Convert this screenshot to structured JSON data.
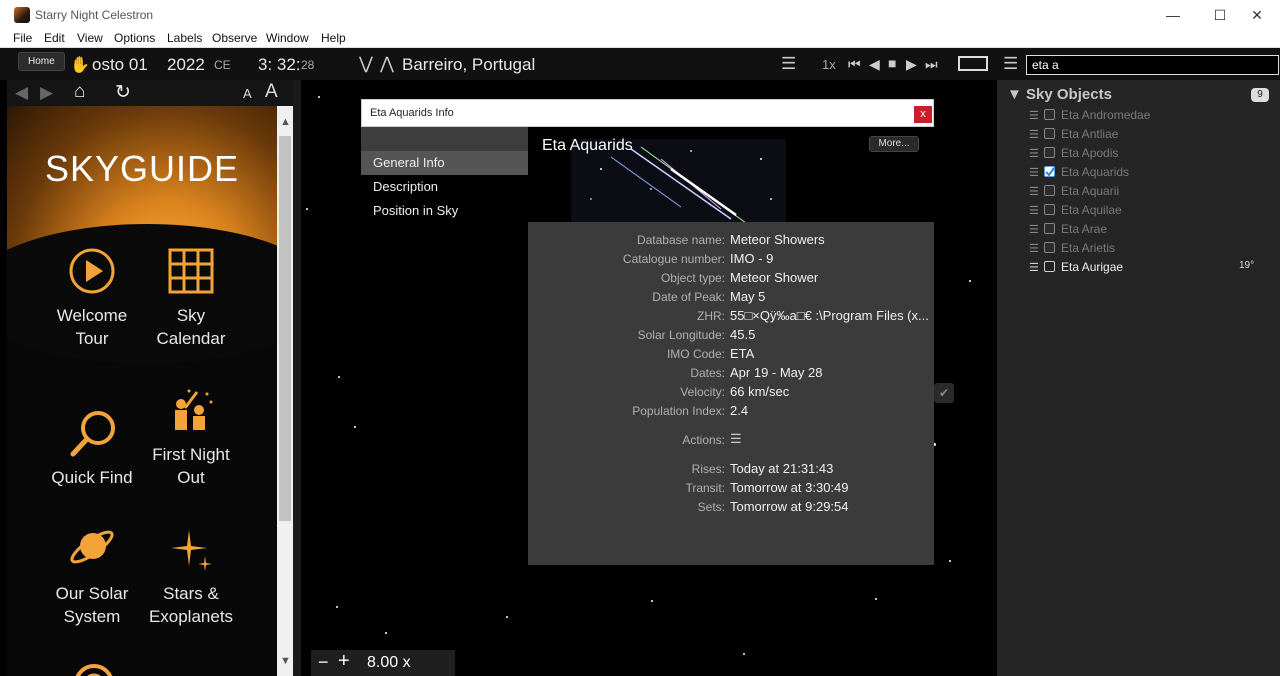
{
  "window": {
    "title": "Starry Night Celestron",
    "minimize": "—",
    "maximize": "☐",
    "close": "✕"
  },
  "menu": [
    "File",
    "Edit",
    "View",
    "Options",
    "Labels",
    "Observe",
    "Window",
    "Help"
  ],
  "toolbar": {
    "home_tooltip": "Home",
    "date": "osto 01",
    "year": "2022",
    "era": "CE",
    "time": "3: 32:",
    "seconds": "28",
    "location": "Barreiro, Portugal",
    "time_rate": "1x",
    "search_value": "eta a"
  },
  "left_nav": {
    "font_small": "A",
    "font_large": "A"
  },
  "skyguide": {
    "title": "SKYGUIDE",
    "items": [
      {
        "label1": "Welcome",
        "label2": "Tour"
      },
      {
        "label1": "Sky",
        "label2": "Calendar"
      },
      {
        "label1": "Quick Find",
        "label2": ""
      },
      {
        "label1": "First Night",
        "label2": "Out"
      },
      {
        "label1": "Our Solar",
        "label2": "System"
      },
      {
        "label1": "Stars &",
        "label2": "Exoplanets"
      }
    ]
  },
  "dialog": {
    "title": "Eta Aquarids Info",
    "close": "x",
    "nav": [
      "General Info",
      "Description",
      "Position in Sky"
    ],
    "heading": "Eta Aquarids",
    "more": "More...",
    "fields": [
      {
        "label": "Database name:",
        "value": "Meteor Showers"
      },
      {
        "label": "Catalogue number:",
        "value": "IMO - 9"
      },
      {
        "label": "Object type:",
        "value": "Meteor Shower"
      },
      {
        "label": "Date of Peak:",
        "value": "May 5"
      },
      {
        "label": "ZHR:",
        "value": "55□×Qÿ‰a□€  :\\Program Files (x..."
      },
      {
        "label": "Solar Longitude:",
        "value": "45.5"
      },
      {
        "label": "IMO Code:",
        "value": "ETA"
      },
      {
        "label": "Dates:",
        "value": "Apr 19 - May 28"
      },
      {
        "label": "Velocity:",
        "value": "66 km/sec"
      },
      {
        "label": "Population Index:",
        "value": "2.4"
      }
    ],
    "actions_label": "Actions:",
    "times": [
      {
        "label": "Rises:",
        "value": "Today at 21:31:43"
      },
      {
        "label": "Transit:",
        "value": "Tomorrow at 3:30:49"
      },
      {
        "label": "Sets:",
        "value": "Tomorrow at 9:29:54"
      }
    ]
  },
  "zoom": {
    "minus": "−",
    "plus": "+",
    "level": "8.00 x"
  },
  "sky_objects": {
    "title": "Sky Objects",
    "count": "9",
    "items": [
      {
        "name": "Eta Andromedae",
        "checked": false,
        "extra": ""
      },
      {
        "name": "Eta Antliae",
        "checked": false,
        "extra": ""
      },
      {
        "name": "Eta Apodis",
        "checked": false,
        "extra": ""
      },
      {
        "name": "Eta Aquarids",
        "checked": true,
        "extra": ""
      },
      {
        "name": "Eta Aquarii",
        "checked": false,
        "extra": ""
      },
      {
        "name": "Eta Aquilae",
        "checked": false,
        "extra": ""
      },
      {
        "name": "Eta Arae",
        "checked": false,
        "extra": ""
      },
      {
        "name": "Eta Arietis",
        "checked": false,
        "extra": ""
      },
      {
        "name": "Eta Aurigae",
        "checked": false,
        "extra": "19°"
      }
    ]
  }
}
